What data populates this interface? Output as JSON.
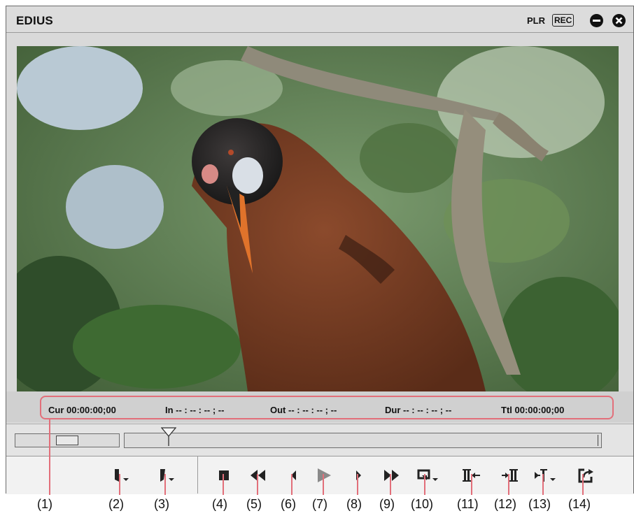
{
  "window": {
    "title": "EDIUS",
    "mode_plr": "PLR",
    "mode_rec": "REC"
  },
  "timecode": {
    "cur": "Cur 00:00:00;00",
    "in": "In -- : -- : -- ; --",
    "out": "Out -- : -- : -- ; --",
    "dur": "Dur -- : -- : -- ; --",
    "ttl": "Ttl 00:00:00;00"
  },
  "controls": [
    {
      "id": "set-in-point",
      "icon": "in-point-icon"
    },
    {
      "id": "set-out-point",
      "icon": "out-point-icon"
    },
    {
      "id": "stop",
      "icon": "stop-icon"
    },
    {
      "id": "rewind",
      "icon": "rewind-icon"
    },
    {
      "id": "previous-frame",
      "icon": "step-back-icon"
    },
    {
      "id": "play",
      "icon": "play-icon"
    },
    {
      "id": "next-frame",
      "icon": "step-forward-icon"
    },
    {
      "id": "fast-forward",
      "icon": "fast-forward-icon"
    },
    {
      "id": "loop-playback",
      "icon": "loop-icon"
    },
    {
      "id": "insert-to-timeline",
      "icon": "insert-icon"
    },
    {
      "id": "overwrite-to-timeline",
      "icon": "overwrite-icon"
    },
    {
      "id": "replace-clip",
      "icon": "replace-icon"
    },
    {
      "id": "export",
      "icon": "export-icon"
    }
  ],
  "callouts": [
    "(1)",
    "(2)",
    "(3)",
    "(4)",
    "(5)",
    "(6)",
    "(7)",
    "(8)",
    "(9)",
    "(10)",
    "(11)",
    "(12)",
    "(13)",
    "(14)"
  ],
  "colors": {
    "callout": "#e26f7a",
    "panel": "#d9d9d9",
    "icon": "#222222",
    "play_disabled": "#8a8a8a"
  }
}
